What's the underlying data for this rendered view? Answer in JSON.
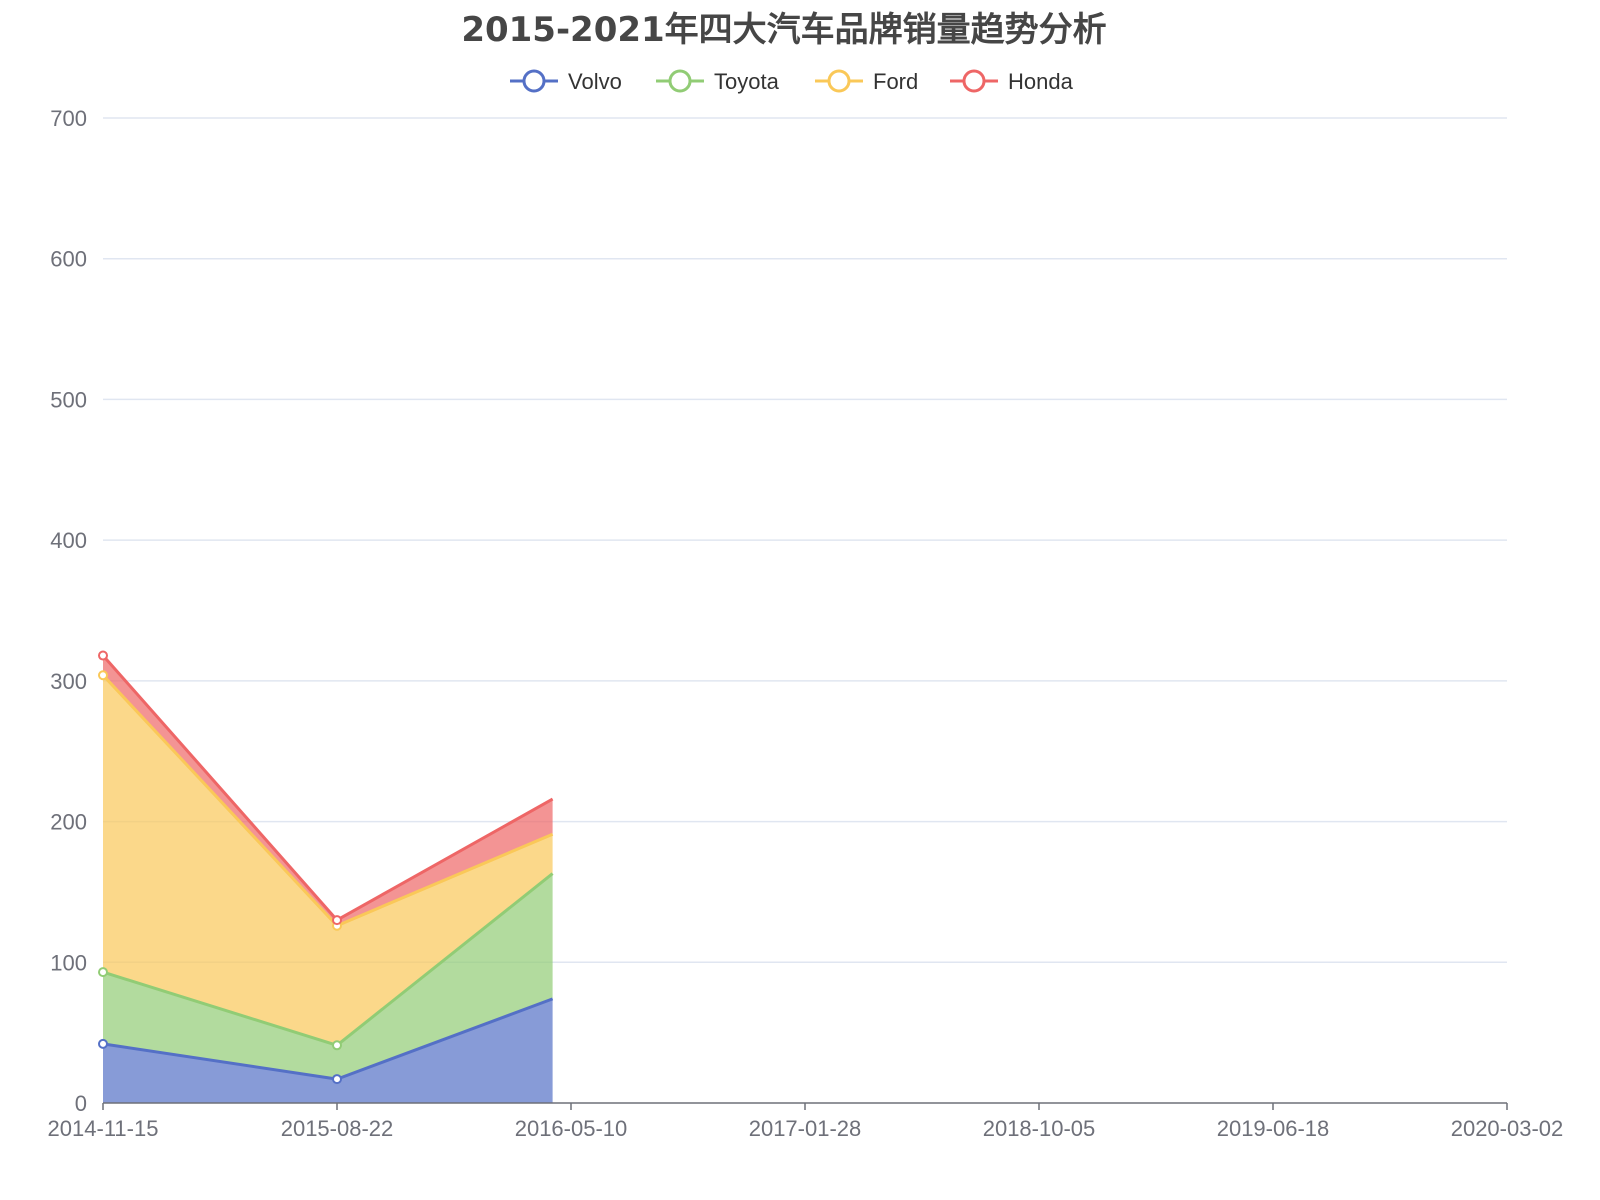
{
  "chart_data": {
    "type": "area",
    "stacked": true,
    "title": "2015-2021年四大汽车品牌销量趋势分析",
    "x_type": "time",
    "x_ticks": [
      "2014-11-15",
      "2015-08-22",
      "2016-05-10",
      "2017-01-28",
      "2018-10-05",
      "2019-06-18",
      "2020-03-02"
    ],
    "ylim": [
      0,
      700
    ],
    "y_ticks": [
      0,
      100,
      200,
      300,
      400,
      500,
      600,
      700
    ],
    "grid": true,
    "legend_position": "top-center",
    "x": [
      "2014-11-15",
      "2015-08-22",
      "2016-05-06"
    ],
    "series": [
      {
        "name": "Volvo",
        "color": "#5470c6",
        "values": [
          42,
          17,
          74
        ]
      },
      {
        "name": "Toyota",
        "color": "#91cc75",
        "values": [
          51,
          24,
          89
        ]
      },
      {
        "name": "Ford",
        "color": "#fac858",
        "values": [
          211,
          85,
          28
        ]
      },
      {
        "name": "Honda",
        "color": "#ee6666",
        "values": [
          14,
          4,
          25
        ]
      }
    ],
    "markers_on_x": [
      "2014-11-15",
      "2015-08-22"
    ]
  }
}
